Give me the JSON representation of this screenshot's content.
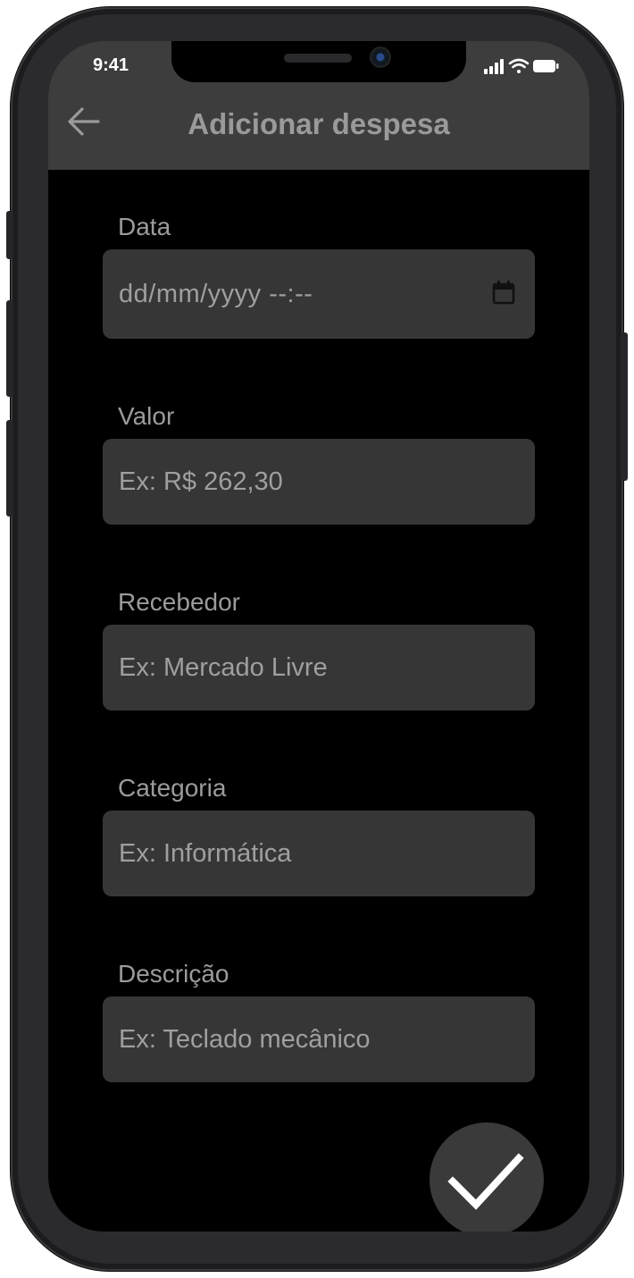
{
  "status_bar": {
    "time": "9:41"
  },
  "app_bar": {
    "title": "Adicionar despesa",
    "back_icon": "arrow-left-icon"
  },
  "form": {
    "data": {
      "label": "Data",
      "placeholder": "dd/mm/yyyy --:--",
      "icon": "calendar-icon"
    },
    "valor": {
      "label": "Valor",
      "placeholder": "Ex: R$ 262,30"
    },
    "recebedor": {
      "label": "Recebedor",
      "placeholder": "Ex: Mercado Livre"
    },
    "categoria": {
      "label": "Categoria",
      "placeholder": "Ex: Informática"
    },
    "descricao": {
      "label": "Descrição",
      "placeholder": "Ex: Teclado mecânico"
    }
  },
  "fab": {
    "icon": "checkmark-icon"
  },
  "colors": {
    "background": "#000000",
    "app_bar": "#3d3d3d",
    "input_background": "#363636",
    "label_text": "#9b9b9b",
    "fab": "#3a3a3a"
  }
}
